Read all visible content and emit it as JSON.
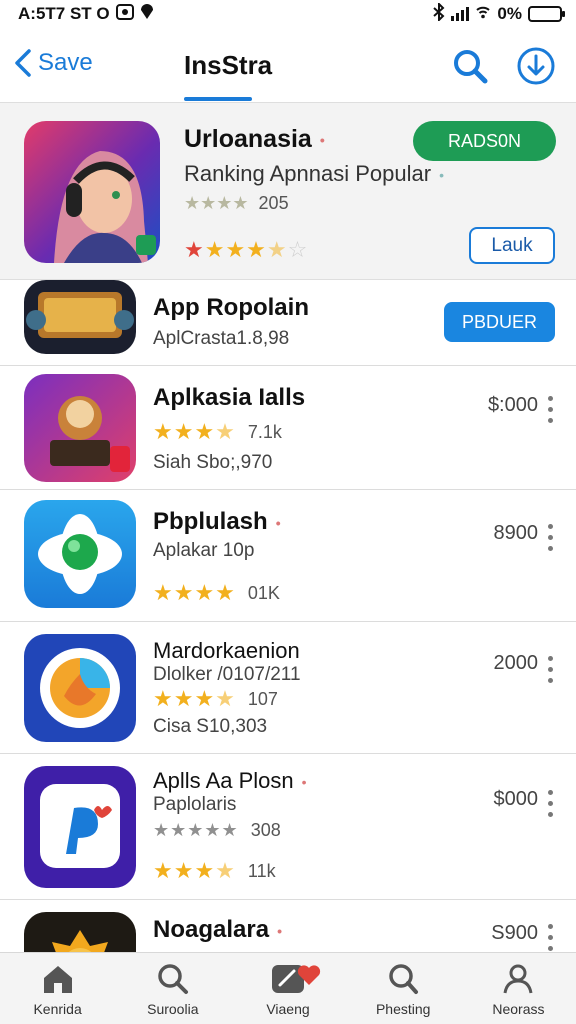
{
  "status_bar": {
    "time": "A:5T7 ST O",
    "battery": "0%"
  },
  "nav": {
    "back_label": "Save",
    "title": "InsStra"
  },
  "featured": {
    "title": "Urloanasia",
    "subtitle": "Ranking Apnnasi Popular",
    "small_rating_count": "205",
    "primary_button": "RADS0N",
    "secondary_button": "Lauk",
    "rating": 3.5
  },
  "apps": [
    {
      "title": "App Ropolain",
      "line1": "AplCrasta1.8,98",
      "button": "PBDUER"
    },
    {
      "title": "Aplkasia Ialls",
      "rating_count": "7.1k",
      "line2": "Siah  Sbo;,970",
      "price": "$:000"
    },
    {
      "title": "Pbplulash",
      "line1": "Aplakar 10p",
      "rating_count": "01K",
      "price": "8900"
    },
    {
      "title": "Mardorkaenion",
      "line1": "Dlolker /0107/211",
      "rating_count": "107",
      "line2": "Cisa  S10,303",
      "price": "2000"
    },
    {
      "title": "Aplls Aa Plosn",
      "line1": "Paplolaris",
      "grey_rating_count": "308",
      "rating_count": "11k",
      "price": "$000"
    },
    {
      "title": "Noagalara",
      "price": "S900"
    }
  ],
  "tabs": [
    {
      "label": "Kenrida"
    },
    {
      "label": "Suroolia"
    },
    {
      "label": "Viaeng"
    },
    {
      "label": "Phesting"
    },
    {
      "label": "Neorass"
    }
  ]
}
